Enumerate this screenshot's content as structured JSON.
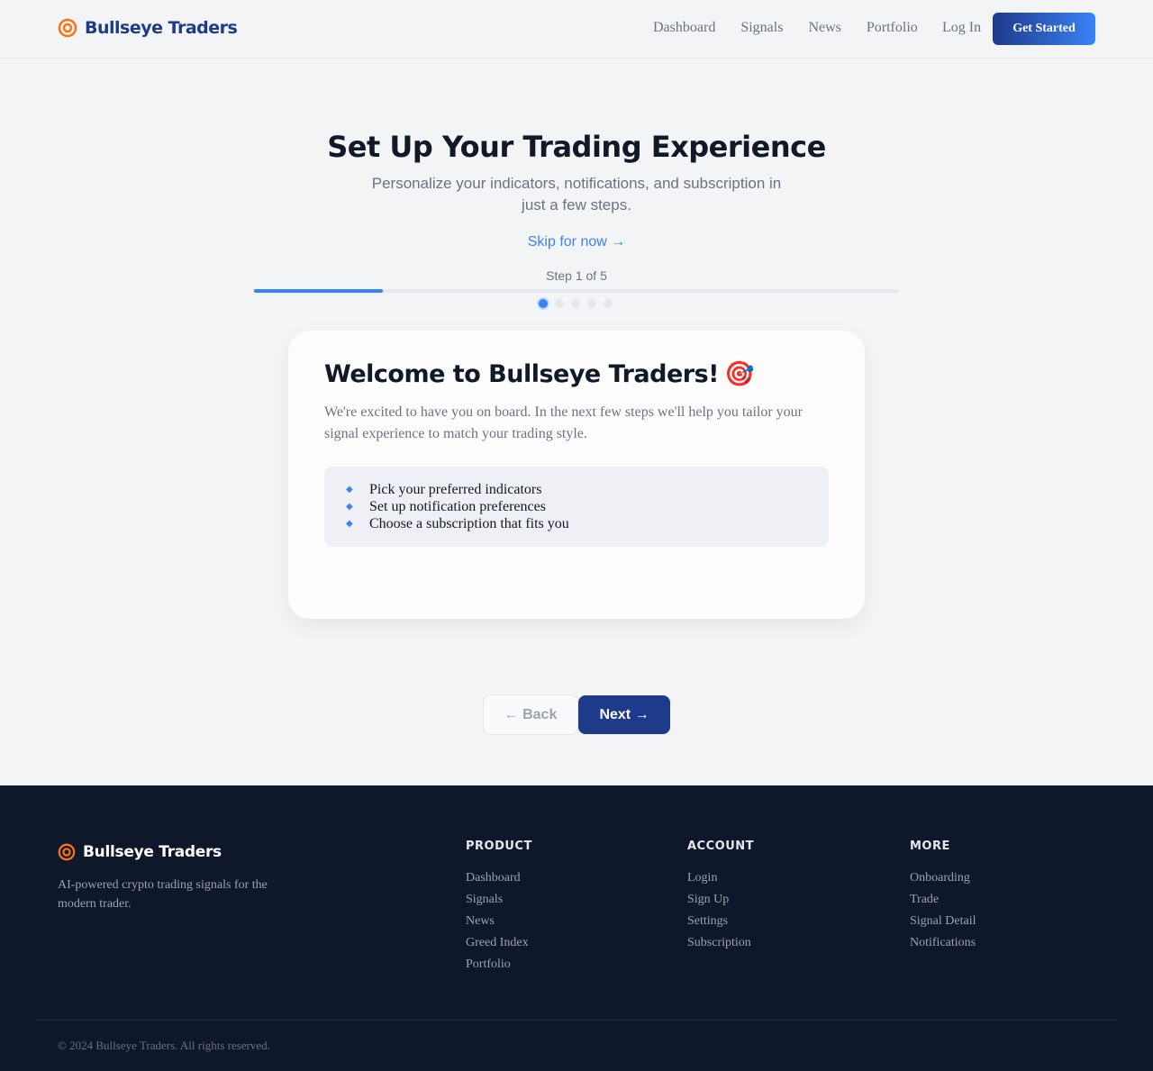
{
  "header": {
    "brand": "Bullseye Traders",
    "nav": [
      "Dashboard",
      "Signals",
      "News",
      "Portfolio"
    ],
    "login": "Log In",
    "cta": "Get Started"
  },
  "hero": {
    "title": "Set Up Your Trading Experience",
    "subtitle": "Personalize your indicators, notifications, and subscription in just a few steps.",
    "skip": "Skip for now →",
    "step_label": "Step 1 of 5",
    "progress_fraction": 0.2,
    "total_steps": 5,
    "current_step": 1
  },
  "card": {
    "title": "Welcome to Bullseye Traders!",
    "emoji": "🎯",
    "text": "We're excited to have you on board. In the next few steps we'll help you tailor your signal experience to match your trading style.",
    "items": [
      "Pick your preferred indicators",
      "Set up notification preferences",
      "Choose a subscription that fits you"
    ]
  },
  "actions": {
    "back": "← Back",
    "next": "Next →"
  },
  "footer": {
    "brand": "Bullseye Traders",
    "tagline": "AI-powered crypto trading signals for the modern trader.",
    "columns": [
      {
        "title": "PRODUCT",
        "links": [
          "Dashboard",
          "Signals",
          "News",
          "Greed Index",
          "Portfolio"
        ]
      },
      {
        "title": "ACCOUNT",
        "links": [
          "Login",
          "Sign Up",
          "Settings",
          "Subscription"
        ]
      },
      {
        "title": "MORE",
        "links": [
          "Onboarding",
          "Trade",
          "Signal Detail",
          "Notifications"
        ]
      }
    ],
    "copyright": "© 2024 Bullseye Traders. All rights reserved."
  },
  "colors": {
    "brand_navy": "#1e3a8a",
    "accent_blue": "#3b82f6",
    "logo_orange": "#f97316",
    "footer_bg": "#0f172a"
  }
}
